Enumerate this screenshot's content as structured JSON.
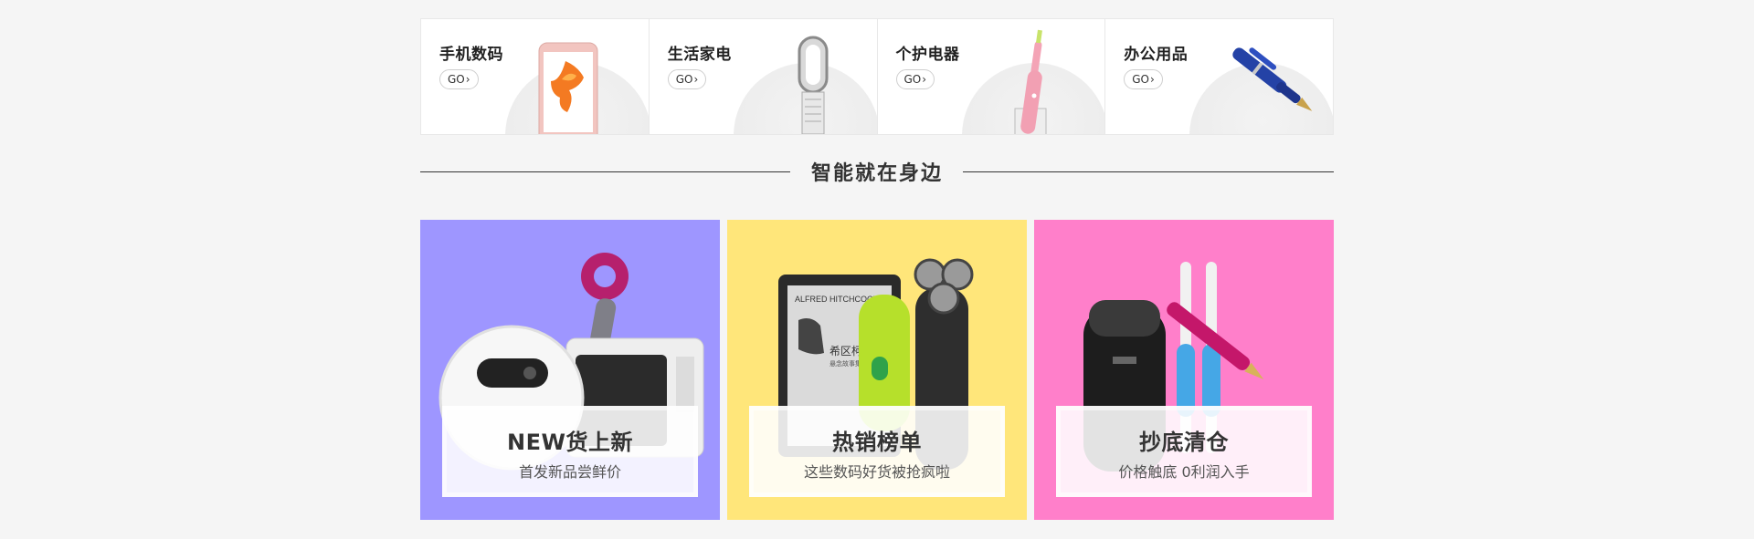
{
  "categories": [
    {
      "title": "手机数码",
      "go": "GO",
      "image": "phone-icon"
    },
    {
      "title": "生活家电",
      "go": "GO",
      "image": "fan-icon"
    },
    {
      "title": "个护电器",
      "go": "GO",
      "image": "toothbrush-icon"
    },
    {
      "title": "办公用品",
      "go": "GO",
      "image": "pen-icon"
    }
  ],
  "section": {
    "title": "智能就在身边"
  },
  "promos": [
    {
      "title": "NEW货上新",
      "subtitle": "首发新品尝鲜价",
      "bg": "#9e96ff"
    },
    {
      "title": "热销榜单",
      "subtitle": "这些数码好货被抢疯啦",
      "bg": "#ffe67a"
    },
    {
      "title": "抄底清仓",
      "subtitle": "价格触底 0利润入手",
      "bg": "#ff7fca"
    }
  ],
  "ereader_text": {
    "brand": "ALFRED HITCHCOCK",
    "title": "希区柯克",
    "subtitle": "悬念故事集"
  }
}
